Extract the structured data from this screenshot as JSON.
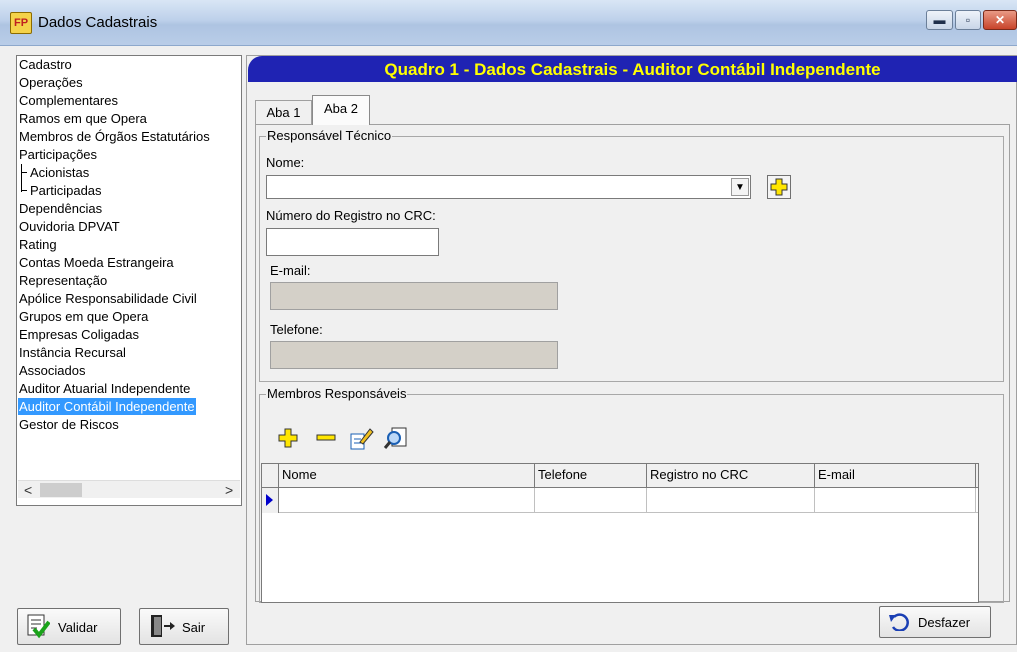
{
  "window": {
    "icon_text": "FP",
    "title": "Dados Cadastrais",
    "min_symbol": "▬",
    "max_symbol": "▫",
    "close_symbol": "✕"
  },
  "nav": {
    "items": [
      {
        "label": "Cadastro"
      },
      {
        "label": "Operações"
      },
      {
        "label": "Complementares"
      },
      {
        "label": "Ramos em que Opera"
      },
      {
        "label": "Membros de Órgãos Estatutários"
      },
      {
        "label": "Participações"
      },
      {
        "label": "Acionistas"
      },
      {
        "label": "Participadas"
      },
      {
        "label": "Dependências"
      },
      {
        "label": "Ouvidoria DPVAT"
      },
      {
        "label": "Rating"
      },
      {
        "label": "Contas Moeda Estrangeira"
      },
      {
        "label": "Representação"
      },
      {
        "label": "Apólice Responsabilidade Civil"
      },
      {
        "label": "Grupos em que Opera"
      },
      {
        "label": "Empresas Coligadas"
      },
      {
        "label": "Instância Recursal"
      },
      {
        "label": "Associados"
      },
      {
        "label": "Auditor Atuarial Independente"
      },
      {
        "label": "Auditor Contábil Independente"
      },
      {
        "label": "Gestor de Riscos"
      }
    ],
    "selected": "Auditor Contábil Independente",
    "scroll_left": "<",
    "scroll_right": ">"
  },
  "buttons": {
    "validar": "Validar",
    "sair": "Sair",
    "desfazer": "Desfazer"
  },
  "header": {
    "title": "Quadro 1 - Dados Cadastrais - Auditor Contábil Independente",
    "bg_color": "#1f23b3",
    "text_color": "#ffff00"
  },
  "tabs": [
    {
      "label": "Aba 1",
      "active": false
    },
    {
      "label": "Aba 2",
      "active": true
    }
  ],
  "responsavel": {
    "legend": "Responsável Técnico",
    "nome_label": "Nome:",
    "nome_value": "",
    "crc_label": "Número do Registro no CRC:",
    "crc_value": "",
    "email_label": "E-mail:",
    "email_value": "",
    "telefone_label": "Telefone:",
    "telefone_value": ""
  },
  "membros": {
    "legend": "Membros Responsáveis",
    "columns": [
      "Nome",
      "Telefone",
      "Registro no CRC",
      "E-mail"
    ],
    "rows": [
      {
        "nome": "",
        "telefone": "",
        "registro": "",
        "email": ""
      }
    ]
  },
  "icons": {
    "add": "plus-icon",
    "remove": "minus-icon",
    "edit": "edit-icon",
    "search": "search-icon",
    "undo": "undo-icon"
  }
}
